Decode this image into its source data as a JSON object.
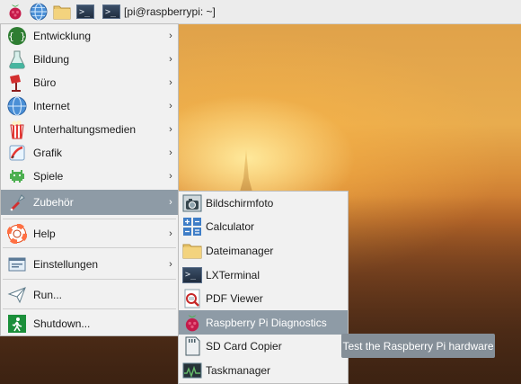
{
  "panel": {
    "task_title": "[pi@raspberrypi: ~]",
    "launchers": [
      "raspberry-icon",
      "globe-icon",
      "folder-icon",
      "terminal-icon"
    ]
  },
  "menu": {
    "items": [
      {
        "label": "Entwicklung",
        "icon": "programming-icon",
        "submenu": true
      },
      {
        "label": "Bildung",
        "icon": "education-icon",
        "submenu": true
      },
      {
        "label": "Büro",
        "icon": "office-icon",
        "submenu": true
      },
      {
        "label": "Internet",
        "icon": "globe-icon",
        "submenu": true
      },
      {
        "label": "Unterhaltungsmedien",
        "icon": "media-icon",
        "submenu": true
      },
      {
        "label": "Grafik",
        "icon": "graphics-icon",
        "submenu": true
      },
      {
        "label": "Spiele",
        "icon": "games-icon",
        "submenu": true
      },
      {
        "label": "Zubehör",
        "icon": "accessories-icon",
        "submenu": true
      },
      {
        "label": "Help",
        "icon": "help-icon",
        "submenu": true
      },
      {
        "label": "Einstellungen",
        "icon": "preferences-icon",
        "submenu": true
      },
      {
        "label": "Run...",
        "icon": "run-icon",
        "submenu": false
      },
      {
        "label": "Shutdown...",
        "icon": "shutdown-icon",
        "submenu": false
      }
    ],
    "selected": "Zubehör",
    "arrow": "›"
  },
  "submenu": {
    "items": [
      {
        "label": "Bildschirmfoto",
        "icon": "camera-icon"
      },
      {
        "label": "Calculator",
        "icon": "calculator-icon"
      },
      {
        "label": "Dateimanager",
        "icon": "folder-icon"
      },
      {
        "label": "LXTerminal",
        "icon": "terminal-icon"
      },
      {
        "label": "PDF Viewer",
        "icon": "pdf-viewer-icon"
      },
      {
        "label": "Raspberry Pi Diagnostics",
        "icon": "raspberry-icon"
      },
      {
        "label": "SD Card Copier",
        "icon": "sd-card-icon"
      },
      {
        "label": "Taskmanager",
        "icon": "task-manager-icon"
      }
    ],
    "selected": "Raspberry Pi Diagnostics"
  },
  "tooltip": {
    "text": "Test the Raspberry Pi hardware"
  },
  "colors": {
    "selection": "#8e9ba6",
    "menu_bg": "#f1f1f1",
    "panel_bg": "#ececec",
    "tooltip_bg": "#858f98"
  }
}
